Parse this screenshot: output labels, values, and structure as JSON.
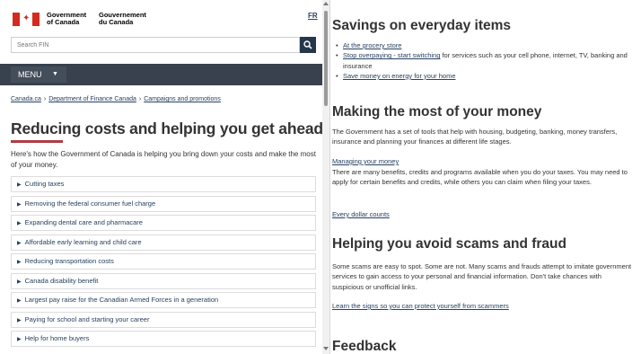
{
  "header": {
    "wordmark_en_line1": "Government",
    "wordmark_en_line2": "of Canada",
    "wordmark_fr_line1": "Gouvernement",
    "wordmark_fr_line2": "du Canada",
    "language_toggle": "FR"
  },
  "search": {
    "placeholder": "Search FIN"
  },
  "menu": {
    "label": "MENU"
  },
  "breadcrumb": [
    {
      "label": "Canada.ca"
    },
    {
      "label": "Department of Finance Canada"
    },
    {
      "label": "Campaigns and promotions"
    }
  ],
  "page": {
    "title": "Reducing costs and helping you get ahead",
    "intro": "Here's how the Government of Canada is helping you bring down your costs and make the most of your money."
  },
  "accordion": [
    {
      "label": "Cutting taxes"
    },
    {
      "label": "Removing the federal consumer fuel charge"
    },
    {
      "label": "Expanding dental care and pharmacare"
    },
    {
      "label": "Affordable early learning and child care"
    },
    {
      "label": "Reducing transportation costs"
    },
    {
      "label": "Canada disability benefit"
    },
    {
      "label": "Largest pay raise for the Canadian Armed Forces in a generation"
    },
    {
      "label": "Paying for school and starting your career"
    },
    {
      "label": "Help for home buyers"
    }
  ],
  "savings": {
    "heading": "Savings on everyday items",
    "items": [
      {
        "link": "At the grocery store",
        "rest": ""
      },
      {
        "link": "Stop overpaying - start switching",
        "rest": " for services such as your cell phone, internet, TV, banking and insurance"
      },
      {
        "link": "Save money on energy for your home",
        "rest": ""
      }
    ]
  },
  "money": {
    "heading": "Making the most of your money",
    "text": "The Government has a set of tools that help with housing, budgeting, banking, money transfers, insurance and planning your finances at different life stages.",
    "link1": "Managing your money",
    "text2": "There are many benefits, credits and programs available when you do your taxes. You may need to apply for certain benefits and credits, while others you can claim when filing your taxes.",
    "link2": "Every dollar counts"
  },
  "scams": {
    "heading": "Helping you avoid scams and fraud",
    "text": "Some scams are easy to spot. Some are not. Many scams and frauds attempt to imitate government services to gain access to your personal and financial information. Don't take chances with suspicious or unofficial links.",
    "link": "Learn the signs so you can protect yourself from scammers"
  },
  "feedback": {
    "heading": "Feedback"
  },
  "colors": {
    "accent_red": "#af3c43",
    "nav_dark": "#38414d",
    "link": "#284162",
    "highlight": "#ffff00"
  }
}
